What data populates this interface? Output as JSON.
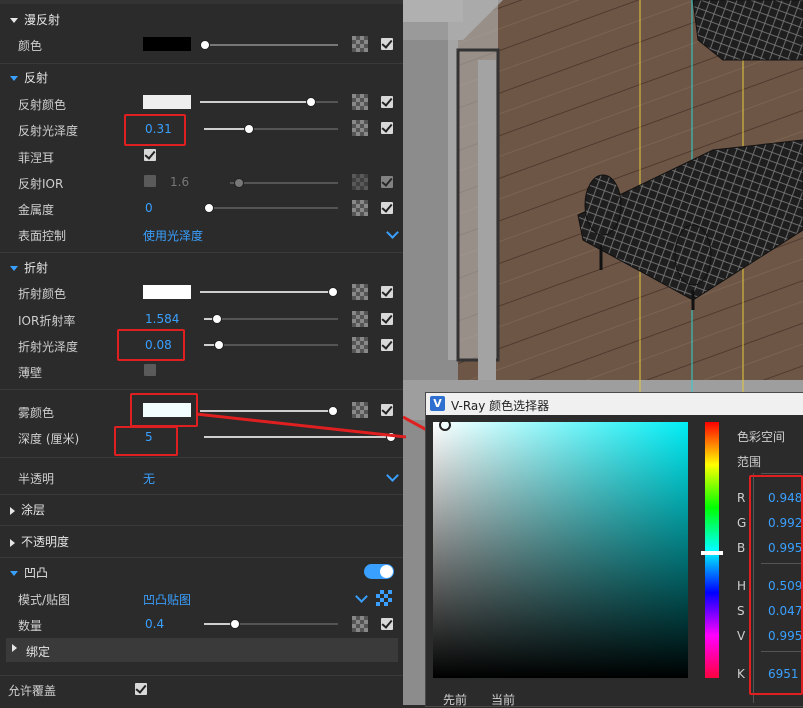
{
  "panel": {
    "diffuse": {
      "title": "漫反射",
      "color_label": "颜色"
    },
    "reflection": {
      "title": "反射",
      "color_label": "反射颜色",
      "gloss_label": "反射光泽度",
      "gloss_value": "0.31",
      "fresnel_label": "菲涅耳",
      "ior_label": "反射IOR",
      "ior_value": "1.6",
      "metal_label": "金属度",
      "metal_value": "0",
      "surface_label": "表面控制",
      "surface_value": "使用光泽度"
    },
    "refraction": {
      "title": "折射",
      "color_label": "折射颜色",
      "ior_label": "IOR折射率",
      "ior_value": "1.584",
      "gloss_label": "折射光泽度",
      "gloss_value": "0.08",
      "thin_label": "薄壁",
      "fog_label": "雾颜色",
      "depth_label": "深度 (厘米)",
      "depth_value": "5"
    },
    "translucency": {
      "label": "半透明",
      "value": "无"
    },
    "coating": {
      "title": "涂层"
    },
    "opacity": {
      "title": "不透明度"
    },
    "bump": {
      "title": "凹凸",
      "mode_label": "模式/贴图",
      "mode_value": "凹凸贴图",
      "amount_label": "数量",
      "amount_value": "0.4"
    },
    "binding": {
      "title": "绑定"
    },
    "allow_override": {
      "label": "允许覆盖"
    }
  },
  "picker": {
    "title": "V-Ray 颜色选择器",
    "color_space_label": "色彩空间",
    "range_label": "范围",
    "r_label": "R",
    "r_value": "0.948",
    "g_label": "G",
    "g_value": "0.992",
    "b_label": "B",
    "b_value": "0.995",
    "h_label": "H",
    "h_value": "0.509",
    "s_label": "S",
    "s_value": "0.047",
    "v_label": "V",
    "v_value": "0.995",
    "k_label": "K",
    "k_value": "6951",
    "before_label": "先前",
    "current_label": "当前"
  },
  "colors": {
    "accent": "#3aa0ff",
    "highlight": "#e02020",
    "fog": "#f2fdfe"
  }
}
